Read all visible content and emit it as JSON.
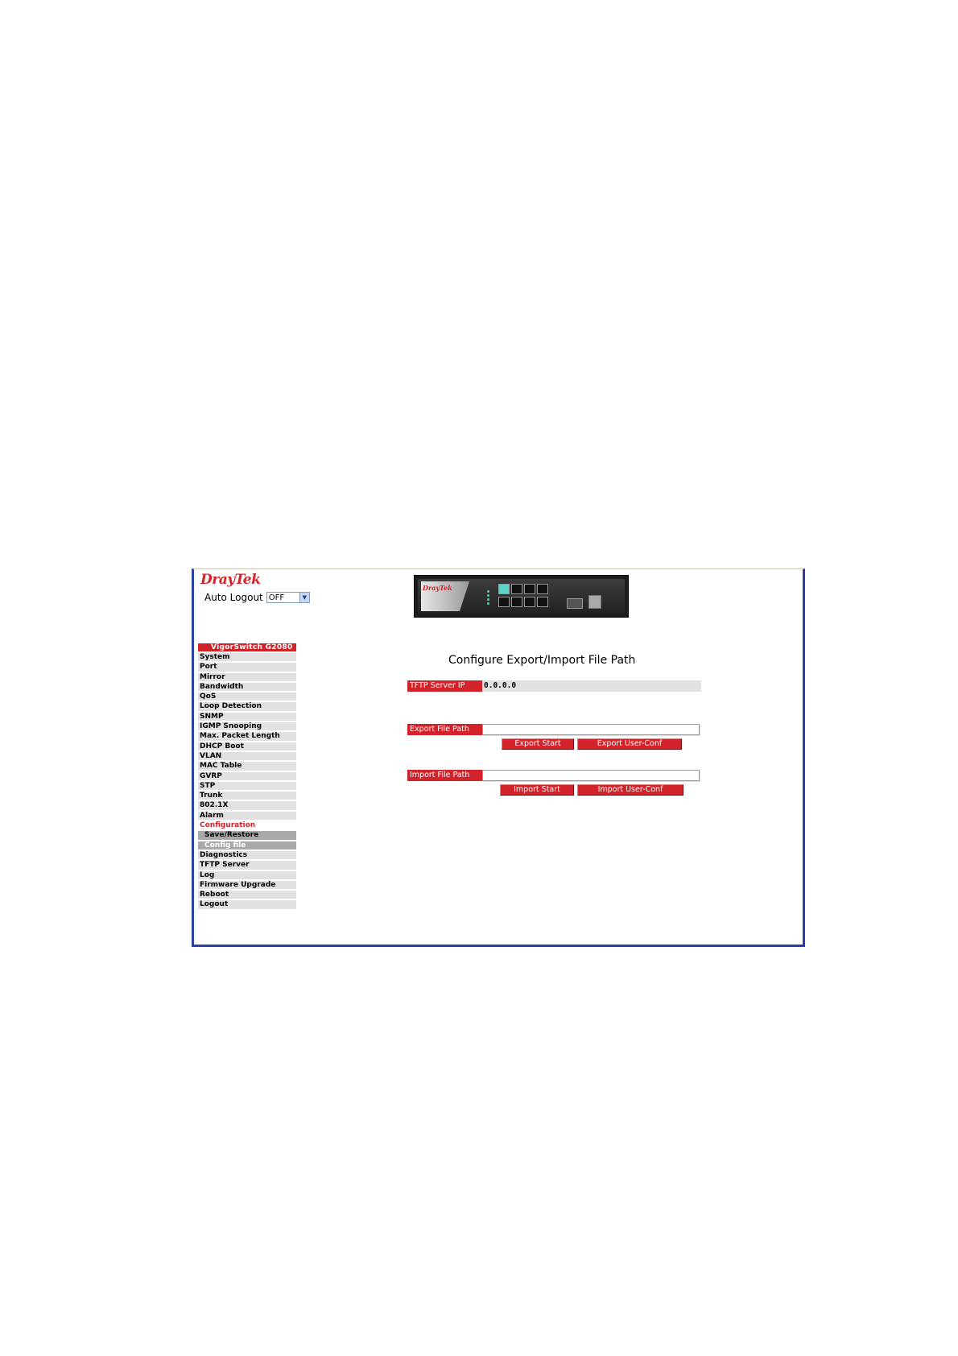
{
  "header": {
    "logo": "DrayTek",
    "auto_logout_label": "Auto Logout",
    "auto_logout_value": "OFF",
    "device_brand": "DrayTek"
  },
  "sidebar": {
    "title": "VigorSwitch G2080",
    "items": [
      "System",
      "Port",
      "Mirror",
      "Bandwidth",
      "QoS",
      "Loop Detection",
      "SNMP",
      "IGMP Snooping",
      "Max. Packet Length",
      "DHCP Boot",
      "VLAN",
      "MAC Table",
      "GVRP",
      "STP",
      "Trunk",
      "802.1X",
      "Alarm"
    ],
    "configuration": "Configuration",
    "sub_items": [
      "Save/Restore",
      "Config file"
    ],
    "items_after": [
      "Diagnostics",
      "TFTP Server",
      "Log",
      "Firmware Upgrade",
      "Reboot",
      "Logout"
    ]
  },
  "main": {
    "title": "Configure Export/Import File Path",
    "tftp_label": "TFTP Server IP",
    "tftp_value": "0.0.0.0",
    "export_label": "Export File Path",
    "export_value": "",
    "export_start": "Export Start",
    "export_user_conf": "Export User-Conf",
    "import_label": "Import File Path",
    "import_value": "",
    "import_start": "Import Start",
    "import_user_conf": "Import User-Conf"
  },
  "colors": {
    "accent_red": "#d2232a",
    "frame_blue": "#2a3fa8",
    "menu_gray": "#e1e1e1"
  }
}
